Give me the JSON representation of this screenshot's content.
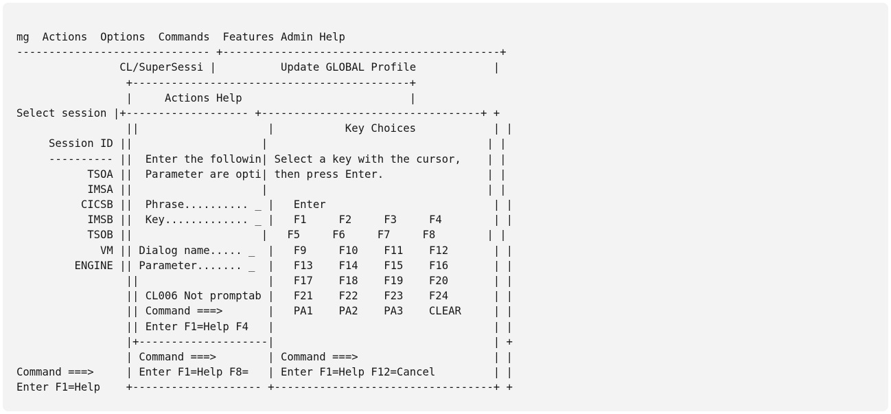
{
  "menu_bar": {
    "items": [
      "mg",
      "Actions",
      "Options",
      "Commands",
      "Features",
      "Admin",
      "Help"
    ]
  },
  "main_panel": {
    "title": "CL/SuperSessi",
    "instruction": "Select session",
    "column_header": "Session ID",
    "column_rule": "----------",
    "sessions": [
      "TSOA",
      "IMSA",
      "CICSB",
      "IMSB",
      "TSOB",
      "VM",
      "ENGINE"
    ],
    "command_prompt": "Command ===>",
    "function_keys": "Enter F1=Help"
  },
  "profile_window": {
    "title": "Update GLOBAL Profile",
    "command_prompt": "Command ===>",
    "function_keys": "Enter F1=Help F8="
  },
  "help_window": {
    "title": "Actions Help",
    "instructions": [
      "Enter the followin",
      "Parameter are opti"
    ],
    "fields": [
      {
        "label": "Phrase.......... ",
        "value": "_"
      },
      {
        "label": "Key............. ",
        "value": "_"
      },
      {
        "label": "Dialog name..... ",
        "value": "_"
      },
      {
        "label": "Parameter....... ",
        "value": "_"
      }
    ],
    "message": "CL006 Not promptab",
    "command_prompt": "Command ===>",
    "function_keys": "Enter F1=Help F4"
  },
  "key_choices": {
    "title": "Key Choices",
    "instructions": [
      "Select a key with the cursor,",
      "then press Enter."
    ],
    "enter_key": "Enter",
    "key_rows": [
      [
        "F1",
        "F2",
        "F3",
        "F4"
      ],
      [
        "F5",
        "F6",
        "F7",
        "F8"
      ],
      [
        "F9",
        "F10",
        "F11",
        "F12"
      ],
      [
        "F13",
        "F14",
        "F15",
        "F16"
      ],
      [
        "F17",
        "F18",
        "F19",
        "F20"
      ],
      [
        "F21",
        "F22",
        "F23",
        "F24"
      ],
      [
        "PA1",
        "PA2",
        "PA3",
        "CLEAR"
      ]
    ],
    "command_prompt": "Command ===>",
    "function_keys": "Enter F1=Help F12=Cancel"
  }
}
